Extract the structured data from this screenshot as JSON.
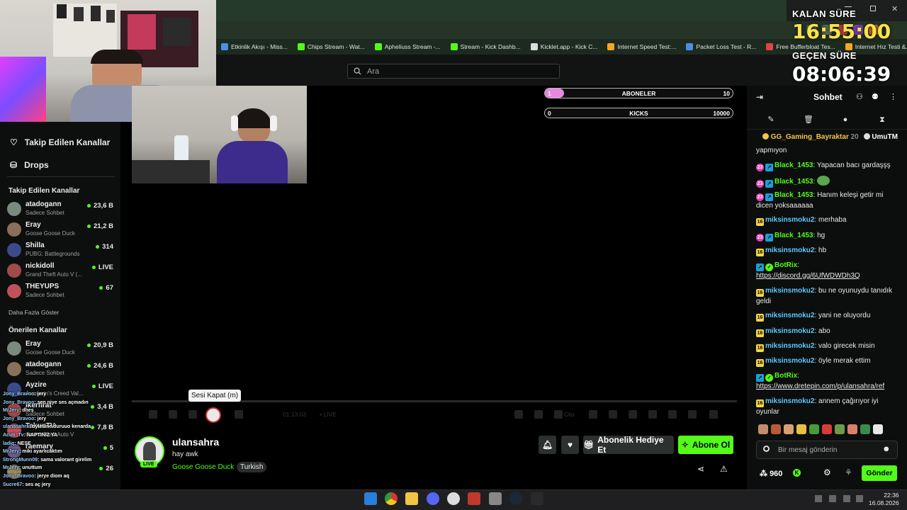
{
  "browser": {
    "bookmarks": [
      {
        "label": "Etkinlik Akışı - Miss...",
        "color": "#4a90e2",
        "icon": "globe-icon"
      },
      {
        "label": "Chips Stream - Wat...",
        "color": "#53fc18",
        "icon": "kick-icon"
      },
      {
        "label": "Apheliuss Stream -...",
        "color": "#53fc18",
        "icon": "kick-icon"
      },
      {
        "label": "Stream - Kick Dashb...",
        "color": "#53fc18",
        "icon": "kick-icon"
      },
      {
        "label": "Kicklet.app - Kick C...",
        "color": "#dddddd",
        "icon": "kicklet-icon"
      },
      {
        "label": "Internet Speed Test:...",
        "color": "#f5a623",
        "icon": "speed-icon"
      },
      {
        "label": "Packet Loss Test - R...",
        "color": "#4a90e2",
        "icon": "packet-icon"
      },
      {
        "label": "Free Bufferbloat Tes...",
        "color": "#e04444",
        "icon": "bufferbloat-icon"
      },
      {
        "label": "Internet Hız Testi &...",
        "color": "#f5a623",
        "icon": "speed-icon"
      }
    ]
  },
  "header": {
    "search_placeholder": "Ara"
  },
  "timer": {
    "remaining_label": "KALAN SÜRE",
    "remaining_value": "16:55:00",
    "elapsed_label": "GEÇEN SÜRE",
    "elapsed_value": "08:06:39"
  },
  "goals": [
    {
      "current": "1",
      "label": "ABONELER",
      "target": "10",
      "progress": 0.1
    },
    {
      "current": "0",
      "label": "KICKS",
      "target": "10000",
      "progress": 0.0
    }
  ],
  "sidebar": {
    "nav": [
      {
        "label": "Takip Edilen Kanallar",
        "icon": "heart-icon"
      },
      {
        "label": "Drops",
        "icon": "drops-icon"
      }
    ],
    "followed_title": "Takip Edilen Kanallar",
    "followed": [
      {
        "name": "atadogann",
        "game": "Sadece Sohbet",
        "viewers": "23,6 B"
      },
      {
        "name": "Eray",
        "game": "Goose Goose Duck",
        "viewers": "21,2 B"
      },
      {
        "name": "Shilla",
        "game": "PUBG: Battlegrounds",
        "viewers": "314"
      },
      {
        "name": "nickidoll",
        "game": "Grand Theft Auto V (...",
        "viewers": "LIVE"
      },
      {
        "name": "THEYUPS",
        "game": "Sadece Sohbet",
        "viewers": "67"
      }
    ],
    "show_more": "Daha Fazla Göster",
    "recommended_title": "Önerilen Kanallar",
    "recommended": [
      {
        "name": "Eray",
        "game": "Goose Goose Duck",
        "viewers": "20,9 B"
      },
      {
        "name": "atadogann",
        "game": "Sadece Sohbet",
        "viewers": "24,6 B"
      },
      {
        "name": "Ayzire",
        "game": "Assassin's Creed Val...",
        "viewers": "LIVE"
      },
      {
        "name": "ikerfirat",
        "game": "Sadece Sohbet",
        "viewers": "3,4 B"
      },
      {
        "name": "TakunTV",
        "game": "Grand Theft Auto V",
        "viewers": "7,8 B"
      },
      {
        "name": "raemary",
        "game": "",
        "viewers": "5"
      },
      {
        "name": "",
        "game": "",
        "viewers": "26"
      }
    ]
  },
  "player": {
    "tooltip": "Sesi Kapat (m)",
    "time": "01:13:03",
    "live_label": "• LIVE",
    "clip_label": "Clip"
  },
  "streamer": {
    "name": "ulansahra",
    "title": "hay awk",
    "category": "Goose Goose Duck",
    "tag": "Turkish",
    "live_badge": "LIVE",
    "gift_label": "Abonelik Hediye Et",
    "subscribe_label": "Abone Ol"
  },
  "chat": {
    "title": "Sohbet",
    "pinned_user": "GG_Gaming_Bayraktar",
    "pinned_count": "20",
    "pinned_user2": "UmuTM",
    "messages": [
      {
        "badges": [],
        "user": "",
        "user_color": "#eaeaea",
        "text": "yapmıyon"
      },
      {
        "badges": [
          "sub23",
          "kick"
        ],
        "user": "Black_1453",
        "user_color": "#53fc18",
        "text": "Yapacan bacı gardaşşş"
      },
      {
        "badges": [
          "sub23",
          "kick"
        ],
        "user": "Black_1453",
        "user_color": "#53fc18",
        "text": ""
      },
      {
        "badges": [
          "sub23",
          "kick"
        ],
        "user": "Black_1453",
        "user_color": "#53fc18",
        "text": "Hanım keleşi getir mi dicen yoksaaaaaa"
      },
      {
        "badges": [
          "sub16"
        ],
        "user": "miksinsmoku2",
        "user_color": "#5ec8ff",
        "text": "merhaba"
      },
      {
        "badges": [
          "sub23",
          "kick"
        ],
        "user": "Black_1453",
        "user_color": "#53fc18",
        "text": "hg"
      },
      {
        "badges": [
          "sub16"
        ],
        "user": "miksinsmoku2",
        "user_color": "#5ec8ff",
        "text": "hb"
      },
      {
        "badges": [
          "kick",
          "ver"
        ],
        "user": "BotRix",
        "user_color": "#53fc18",
        "text": "https://discord.gg/6UfWDWDh3Q"
      },
      {
        "badges": [
          "sub16"
        ],
        "user": "miksinsmoku2",
        "user_color": "#5ec8ff",
        "text": "bu ne oyunuydu tanıdık geldi"
      },
      {
        "badges": [
          "sub16"
        ],
        "user": "miksinsmoku2",
        "user_color": "#5ec8ff",
        "text": "yani ne oluyordu"
      },
      {
        "badges": [
          "sub16"
        ],
        "user": "miksinsmoku2",
        "user_color": "#5ec8ff",
        "text": "abo"
      },
      {
        "badges": [
          "sub16"
        ],
        "user": "miksinsmoku2",
        "user_color": "#5ec8ff",
        "text": "valo girecek misin"
      },
      {
        "badges": [
          "sub16"
        ],
        "user": "miksinsmoku2",
        "user_color": "#5ec8ff",
        "text": "öyle merak ettim"
      },
      {
        "badges": [
          "kick",
          "ver"
        ],
        "user": "BotRix",
        "user_color": "#53fc18",
        "text": "https://www.dretepin.com/p/ulansahra/ref"
      },
      {
        "badges": [
          "sub16"
        ],
        "user": "miksinsmoku2",
        "user_color": "#5ec8ff",
        "text": "annem çağırıyor iyi oyunlar"
      }
    ],
    "input_placeholder": "Bir mesaj gönderin",
    "points": "960",
    "send_label": "Gönder"
  },
  "overlay_chat": [
    {
      "user": "Jony_Bravoo",
      "text": ": jery"
    },
    {
      "user": "Jony_Bravoo",
      "text": ": sen niye ses açmadın"
    },
    {
      "user": "MrJery",
      "text": ": dheş"
    },
    {
      "user": "Jony_Bravoo",
      "text": ": jery"
    },
    {
      "user": "ulanasahra",
      "text": ": oylesine duruuo kenarda"
    },
    {
      "user": "Acuti_Tv",
      "text": ": NAPTINIZ YA"
    },
    {
      "user": "ladiq",
      "text": ": NEŞE"
    },
    {
      "user": "MrJery",
      "text": ": miki ayarlıcaktım"
    },
    {
      "user": "StrongMunn09",
      "text": ": sama valorant girelim"
    },
    {
      "user": "MrJery",
      "text": ": unuttum"
    },
    {
      "user": "Jony_Bravoo",
      "text": ": jerye diom aq"
    },
    {
      "user": "Sucre67",
      "text": ": ses aç jery"
    },
    {
      "user": "Acuti_Tv",
      "text": ": OLUR BUZLU OLSUN"
    }
  ],
  "taskbar": {
    "time": "22:36",
    "date": "16.08.2026"
  }
}
